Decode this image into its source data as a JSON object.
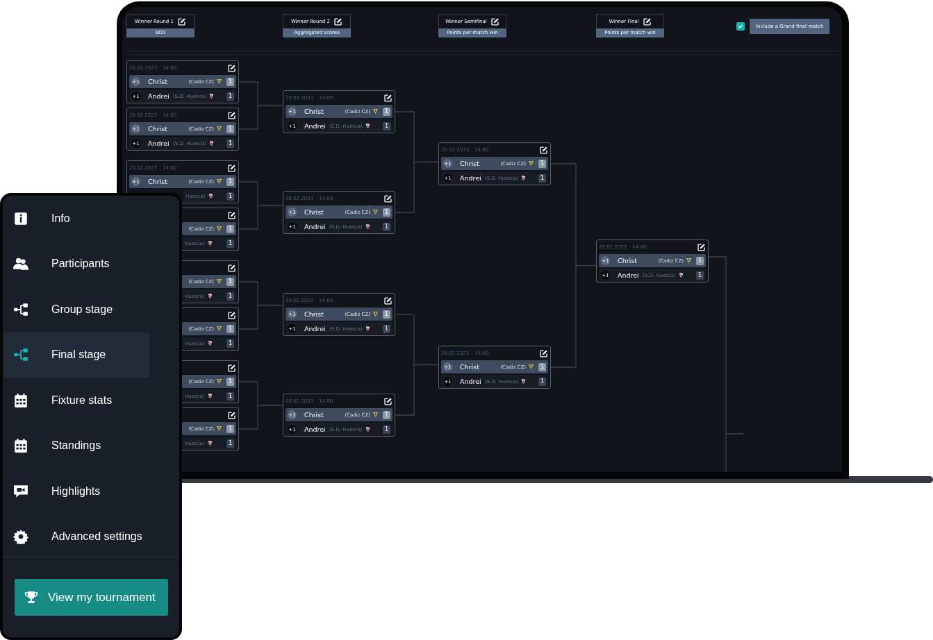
{
  "header": {
    "rounds": [
      {
        "title": "Winner Round 1",
        "scoring": "BO3"
      },
      {
        "title": "Winner Round 2",
        "scoring": "Aggregated scores"
      },
      {
        "title": "Winner Semifinal",
        "scoring": "Points per match win"
      },
      {
        "title": "Winner Final",
        "scoring": "Points per match win"
      }
    ],
    "grand_final": {
      "checked": true,
      "label": "Include a Grand final match"
    }
  },
  "bracket": {
    "rounds": [
      {
        "matches": [
          {
            "date": "20.02.2023",
            "time": "14:00",
            "players": [
              {
                "badge": "+1",
                "name": "Christ",
                "team": "(Cadiz CZ)",
                "score": "1",
                "highlighted": true
              },
              {
                "badge": "+1",
                "name": "Andrei",
                "team": "(S.D. Huesca)",
                "score": "1",
                "highlighted": false
              }
            ]
          },
          {
            "date": "20.02.2023",
            "time": "14:00",
            "players": [
              {
                "badge": "+1",
                "name": "Christ",
                "team": "(Cadiz CZ)",
                "score": "1",
                "highlighted": true
              },
              {
                "badge": "+1",
                "name": "Andrei",
                "team": "(S.D. Huesca)",
                "score": "1",
                "highlighted": false
              }
            ]
          },
          {
            "date": "20.02.2023",
            "time": "14:00",
            "players": [
              {
                "badge": "+1",
                "name": "Christ",
                "team": "(Cadiz CZ)",
                "score": "1",
                "highlighted": true
              },
              {
                "team": "Huesca)",
                "score": "1",
                "highlighted": false
              }
            ]
          },
          {
            "players": [
              {
                "team": "(Cadiz CZ)",
                "score": "1",
                "highlighted": true
              },
              {
                "team": "Huesca)",
                "score": "1",
                "highlighted": false
              }
            ]
          },
          {
            "players": [
              {
                "team": "(Cadiz CZ)",
                "score": "1",
                "highlighted": true
              },
              {
                "team": "Huesca)",
                "score": "1",
                "highlighted": false
              }
            ]
          },
          {
            "players": [
              {
                "team": "(Cadiz CZ)",
                "score": "1",
                "highlighted": true
              },
              {
                "team": "Huesca)",
                "score": "1",
                "highlighted": false
              }
            ]
          },
          {
            "players": [
              {
                "team": "(Cadiz CZ)",
                "score": "1",
                "highlighted": true
              },
              {
                "team": "Huesca)",
                "score": "1",
                "highlighted": false
              }
            ]
          },
          {
            "players": [
              {
                "team": "(Cadiz CZ)",
                "score": "1",
                "highlighted": true
              },
              {
                "team": "Huesca)",
                "score": "1",
                "highlighted": false
              }
            ]
          }
        ]
      },
      {
        "matches": [
          {
            "date": "20.02.2023",
            "time": "14:00",
            "players": [
              {
                "badge": "+1",
                "name": "Christ",
                "team": "(Cadiz CZ)",
                "score": "1",
                "highlighted": true
              },
              {
                "badge": "+1",
                "name": "Andrei",
                "team": "(S.D. Huesca)",
                "score": "1",
                "highlighted": false
              }
            ]
          },
          {
            "date": "20.02.2023",
            "time": "14:00",
            "players": [
              {
                "badge": "+1",
                "name": "Christ",
                "team": "(Cadiz CZ)",
                "score": "1",
                "highlighted": true
              },
              {
                "badge": "+1",
                "name": "Andrei",
                "team": "(S.D. Huesca)",
                "score": "1",
                "highlighted": false
              }
            ]
          },
          {
            "date": "20.02.2023",
            "time": "14:00",
            "players": [
              {
                "badge": "+1",
                "name": "Christ",
                "team": "(Cadiz CZ)",
                "score": "1",
                "highlighted": true
              },
              {
                "badge": "+1",
                "name": "Andrei",
                "team": "(S.D. Huesca)",
                "score": "1",
                "highlighted": false
              }
            ]
          },
          {
            "date": "20.02.2023",
            "time": "14:00",
            "players": [
              {
                "badge": "+1",
                "name": "Christ",
                "team": "(Cadiz CZ)",
                "score": "1",
                "highlighted": true
              },
              {
                "badge": "+1",
                "name": "Andrei",
                "team": "(S.D. Huesca)",
                "score": "1",
                "highlighted": false
              }
            ]
          }
        ]
      },
      {
        "matches": [
          {
            "date": "20.02.2023",
            "time": "14:00",
            "players": [
              {
                "badge": "+1",
                "name": "Christ",
                "team": "(Cadiz CZ)",
                "score": "1",
                "highlighted": true
              },
              {
                "badge": "+1",
                "name": "Andrei",
                "team": "(S.D. Huesca)",
                "score": "1",
                "highlighted": false
              }
            ]
          },
          {
            "date": "20.02.2023",
            "time": "14:00",
            "players": [
              {
                "badge": "+1",
                "name": "Christ",
                "team": "(Cadiz CZ)",
                "score": "1",
                "highlighted": true
              },
              {
                "badge": "+1",
                "name": "Andrei",
                "team": "(S.D. Huesca)",
                "score": "1",
                "highlighted": false
              }
            ]
          }
        ]
      },
      {
        "matches": [
          {
            "date": "20.02.2023",
            "time": "14:00",
            "players": [
              {
                "badge": "+1",
                "name": "Christ",
                "team": "(Cadiz CZ)",
                "score": "1",
                "highlighted": true
              },
              {
                "badge": "+1",
                "name": "Andrei",
                "team": "(S.D. Huesca)",
                "score": "1",
                "highlighted": false
              }
            ]
          }
        ]
      }
    ]
  },
  "sidebar": {
    "items": [
      {
        "label": "Info",
        "selected": false
      },
      {
        "label": "Participants",
        "selected": false
      },
      {
        "label": "Group stage",
        "selected": false
      },
      {
        "label": "Final stage",
        "selected": true
      },
      {
        "label": "Fixture stats",
        "selected": false
      },
      {
        "label": "Standings",
        "selected": false
      },
      {
        "label": "Highlights",
        "selected": false
      },
      {
        "label": "Advanced settings",
        "selected": false
      }
    ],
    "button": "View my tournament"
  }
}
